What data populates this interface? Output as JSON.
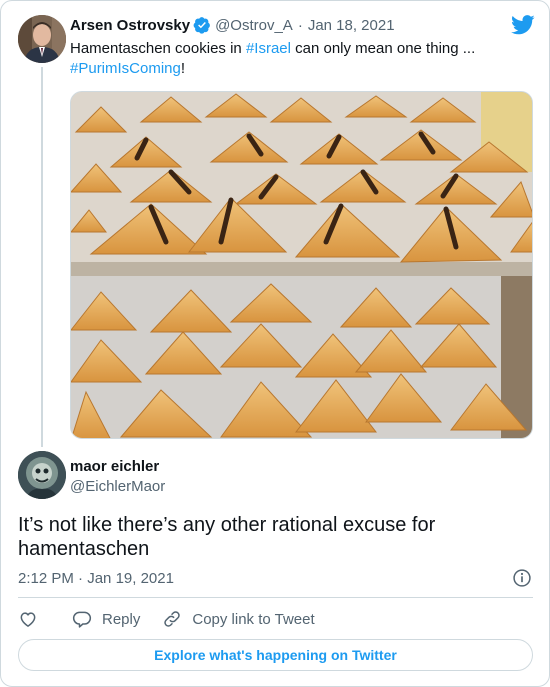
{
  "colors": {
    "accent": "#1d9bf0",
    "text": "#0f1419",
    "secondary": "#536471",
    "border": "#cfd9de"
  },
  "parent_tweet": {
    "name": "Arsen Ostrovsky",
    "handle": "@Ostrov_A",
    "separator": "·",
    "date": "Jan 18, 2021",
    "text_part1": "Hamentaschen cookies in ",
    "hashtag1": "#Israel",
    "text_part2": " can only mean one thing ...",
    "hashtag2": "#PurimIsComing",
    "text_part3": "!",
    "verified_icon": "verified-badge-icon",
    "media_description_icon": "photo"
  },
  "reply_tweet": {
    "name": "maor eichler",
    "handle": "@EichlerMaor",
    "text": "It’s not like there’s any other rational excuse for hamentaschen",
    "time": "2:12 PM",
    "separator": "·",
    "date": "Jan 19, 2021"
  },
  "actions": {
    "like_icon": "heart-icon",
    "reply_label": "Reply",
    "copy_label": "Copy link to Tweet"
  },
  "footer": {
    "explore_label": "Explore what's happening on Twitter"
  }
}
